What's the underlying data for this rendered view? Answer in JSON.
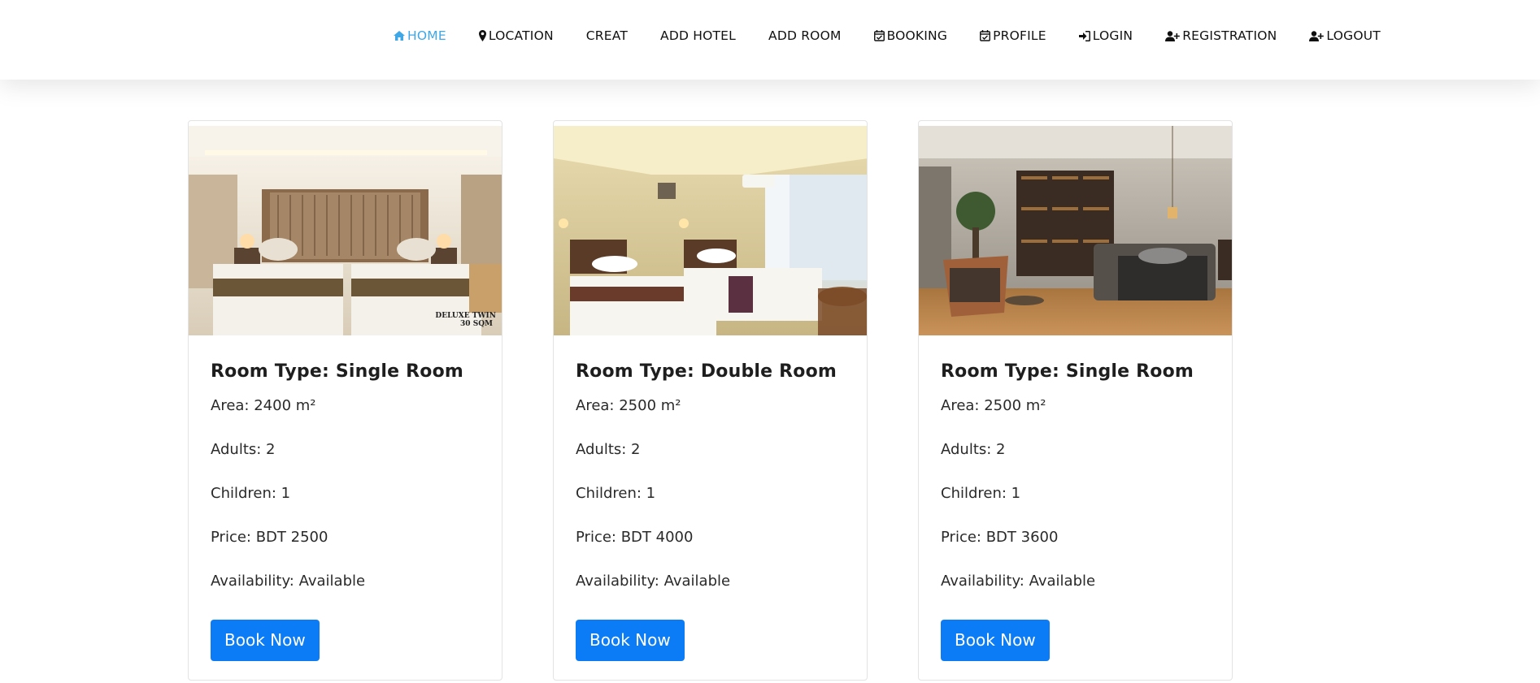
{
  "nav": {
    "items": [
      {
        "label": "HOME",
        "icon": "home-icon",
        "active": true
      },
      {
        "label": "LOCATION",
        "icon": "map-marker-icon",
        "active": false
      },
      {
        "label": "CREAT",
        "icon": "",
        "active": false
      },
      {
        "label": "ADD HOTEL",
        "icon": "",
        "active": false
      },
      {
        "label": "ADD ROOM",
        "icon": "",
        "active": false
      },
      {
        "label": "BOOKING",
        "icon": "calendar-check-icon",
        "active": false
      },
      {
        "label": "PROFILE",
        "icon": "calendar-check-icon",
        "active": false
      },
      {
        "label": "LOGIN",
        "icon": "sign-in-icon",
        "active": false
      },
      {
        "label": "REGISTRATION",
        "icon": "user-plus-icon",
        "active": false
      },
      {
        "label": "LOGOUT",
        "icon": "user-plus-icon",
        "active": false
      }
    ],
    "active_color": "#3fa7e6"
  },
  "rooms": [
    {
      "image_caption_line1": "DELUXE TWIN",
      "image_caption_line2": "30 SQM",
      "title": "Room Type: Single Room",
      "area": "Area: 2400 m²",
      "adults": "Adults: 2",
      "children": "Children: 1",
      "price": "Price: BDT 2500",
      "availability": "Availability: Available",
      "button_label": "Book Now"
    },
    {
      "title": "Room Type: Double Room",
      "area": "Area: 2500 m²",
      "adults": "Adults: 2",
      "children": "Children: 1",
      "price": "Price: BDT 4000",
      "availability": "Availability: Available",
      "button_label": "Book Now"
    },
    {
      "title": "Room Type: Single Room",
      "area": "Area: 2500 m²",
      "adults": "Adults: 2",
      "children": "Children: 1",
      "price": "Price: BDT 3600",
      "availability": "Availability: Available",
      "button_label": "Book Now"
    }
  ],
  "colors": {
    "button": "#0b7cf6",
    "nav_active": "#3fa7e6"
  }
}
